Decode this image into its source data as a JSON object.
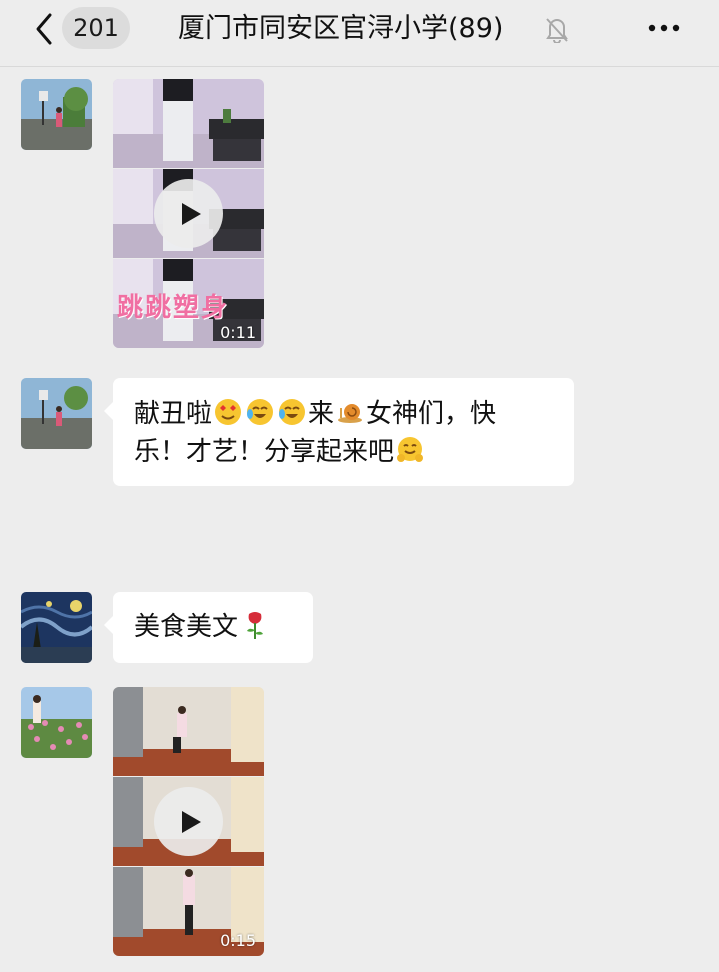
{
  "header": {
    "unread_count": "201",
    "title": "厦门市同安区官浔小学(89)"
  },
  "messages": [
    {
      "type": "video",
      "duration": "0:11",
      "caption_text": "跳跳塑身"
    },
    {
      "type": "text",
      "line1": "献丑啦",
      "line1_b": "来",
      "line1_c": "女神们，快",
      "line2": "乐！才艺！分享起来吧"
    },
    {
      "type": "text",
      "text": "美食美文"
    },
    {
      "type": "video",
      "duration": "0:15"
    }
  ],
  "icons": {
    "back": "chevron-left-icon",
    "mute": "bell-slash-icon",
    "more": "ellipsis-icon",
    "play": "play-icon"
  }
}
